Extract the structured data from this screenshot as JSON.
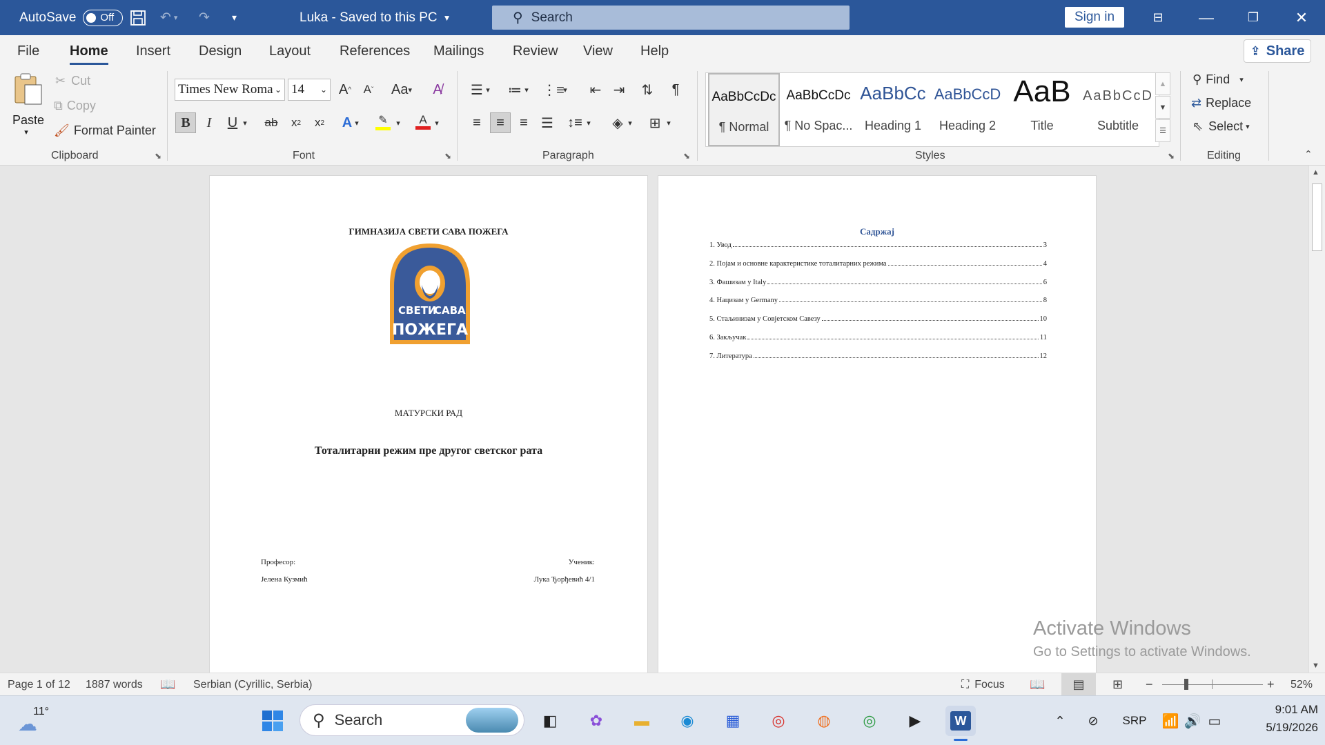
{
  "titlebar": {
    "autosave_label": "AutoSave",
    "autosave_state": "Off",
    "doc_title": "Luka  -  Saved to this PC",
    "search_placeholder": "Search",
    "signin_label": "Sign in"
  },
  "tabs": [
    "File",
    "Home",
    "Insert",
    "Design",
    "Layout",
    "References",
    "Mailings",
    "Review",
    "View",
    "Help"
  ],
  "active_tab": "Home",
  "share_label": "Share",
  "clipboard": {
    "paste": "Paste",
    "cut": "Cut",
    "copy": "Copy",
    "format_painter": "Format Painter",
    "label": "Clipboard"
  },
  "font": {
    "name": "Times New Roma",
    "size": "14",
    "label": "Font"
  },
  "paragraph": {
    "label": "Paragraph"
  },
  "styles": {
    "label": "Styles",
    "items": [
      {
        "preview": "AaBbCcDc",
        "name": "¶ Normal"
      },
      {
        "preview": "AaBbCcDc",
        "name": "¶ No Spac..."
      },
      {
        "preview": "AaBbCc",
        "name": "Heading 1"
      },
      {
        "preview": "AaBbCcD",
        "name": "Heading 2"
      },
      {
        "preview": "AaB",
        "name": "Title"
      },
      {
        "preview": "AaBbCcD",
        "name": "Subtitle"
      }
    ]
  },
  "editing": {
    "find": "Find",
    "replace": "Replace",
    "select": "Select",
    "label": "Editing"
  },
  "page1": {
    "school": "ГИМНАЗИЈА СВЕТИ САВА ПОЖЕГА",
    "logo_text_top": "СВЕТИ",
    "logo_text_right": "САВА",
    "logo_text_bottom": "ПОЖЕГА",
    "kind": "МАТУРСКИ РАД",
    "title": "Тоталитарни режим пре другог светског рата",
    "prof_label": "Професор:",
    "prof_name": "Јелена Кузмић",
    "student_label": "Ученик:",
    "student_name": "Лука Ђорђевић 4/1"
  },
  "page2": {
    "toc_title": "Садржај",
    "toc": [
      {
        "text": "1. Увод",
        "page": "3"
      },
      {
        "text": "2. Појам и основне карактеристике тоталитарних режима",
        "page": "4"
      },
      {
        "text": "3. Фашизам у Italy",
        "page": "6"
      },
      {
        "text": "4. Нацизам у Germany",
        "page": "8"
      },
      {
        "text": "5. Стаљинизам у Совјетском  Савезу",
        "page": "10"
      },
      {
        "text": "6. Закључак",
        "page": "11"
      },
      {
        "text": "7. Литература",
        "page": "12"
      }
    ]
  },
  "watermark": {
    "line1": "Activate Windows",
    "line2": "Go to Settings to activate Windows."
  },
  "statusbar": {
    "page": "Page 1 of 12",
    "words": "1887 words",
    "language": "Serbian (Cyrillic, Serbia)",
    "focus": "Focus",
    "zoom": "52%"
  },
  "taskbar": {
    "weather": "11°",
    "search": "Search",
    "lang": "SRP",
    "time": "9:01 AM",
    "date": "5/19/2026"
  },
  "colors": {
    "word_blue": "#2b579a",
    "heading_blue": "#2f5496",
    "logo_orange": "#f0a030",
    "logo_blue": "#3a5a9a"
  }
}
